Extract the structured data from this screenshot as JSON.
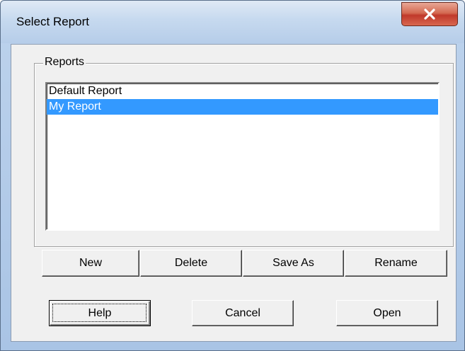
{
  "window": {
    "title": "Select Report"
  },
  "group": {
    "label": "Reports"
  },
  "reports": [
    {
      "label": "Default Report",
      "selected": false
    },
    {
      "label": "My Report",
      "selected": true
    }
  ],
  "actions": {
    "new_label": "New",
    "delete_label": "Delete",
    "save_as_label": "Save As",
    "rename_label": "Rename"
  },
  "footer": {
    "help_label": "Help",
    "cancel_label": "Cancel",
    "open_label": "Open"
  },
  "colors": {
    "selection": "#3399ff",
    "close_button": "#c0392b"
  }
}
